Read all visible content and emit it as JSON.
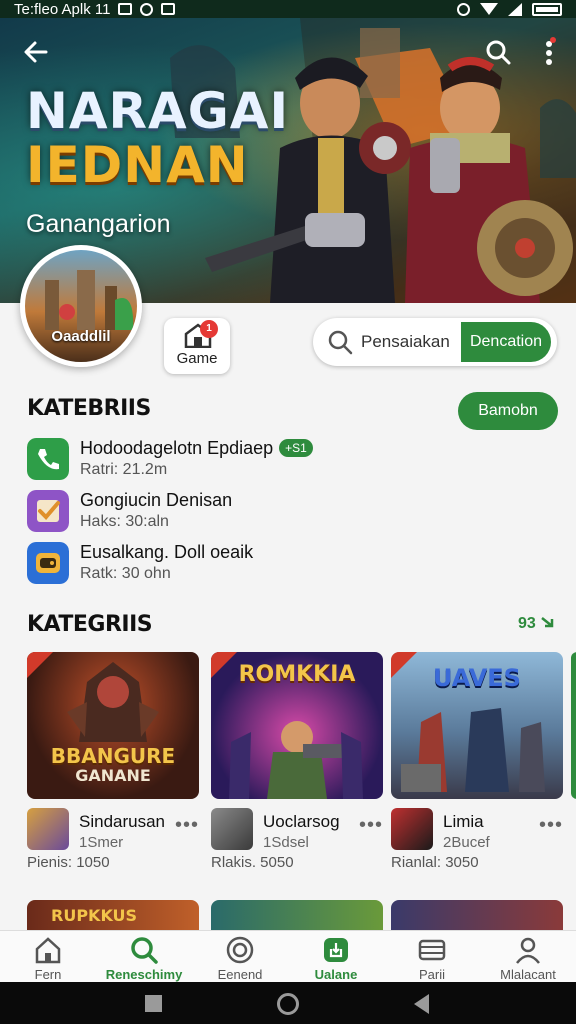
{
  "status_bar": {
    "left_text": "Te:fleo Aplk 11"
  },
  "hero": {
    "title_line1": "NARAGAI",
    "title_line2": "IEDNAN",
    "subtitle": "Ganangarion"
  },
  "avatar": {
    "label": "Oaaddlil"
  },
  "game_chip": {
    "label": "Game",
    "badge": "1"
  },
  "search": {
    "placeholder": "Pensaiakan",
    "button_label": "Dencation"
  },
  "section1": {
    "title": "KATEBRIIS",
    "button_label": "Bamobn",
    "items": [
      {
        "title": "Hodoodagelotn Epdiaep",
        "tag": "+S1",
        "meta": "Ratri: 21.2m",
        "icon": "phone-icon",
        "color": "#2e9e48"
      },
      {
        "title": "Gongiucin Denisan",
        "meta": "Haks: 30:aln",
        "icon": "check-icon",
        "color": "#8e54c6"
      },
      {
        "title": "Eusalkang. Doll oeaik",
        "meta": "Ratk: 30 ohn",
        "icon": "gamepad-icon",
        "color": "#2b6fd6"
      }
    ]
  },
  "section2": {
    "title": "KATEGRIIS",
    "see_all": "93",
    "cards": [
      {
        "thumb_title": "BBANGURE",
        "thumb_sub": "GANANE",
        "name": "Sindarusan",
        "sub": "1Smer",
        "price": "Pienis: 1050"
      },
      {
        "thumb_title": "ROMKKIA",
        "thumb_sub": "",
        "name": "Uoclarsog",
        "sub": "1Sdsel",
        "price": "Rlakis. 5050"
      },
      {
        "thumb_title": "UAVES",
        "thumb_sub": "",
        "name": "Limia",
        "sub": "2Bucef",
        "price": "Rianlal: 3050"
      }
    ],
    "row2_titles": [
      "RUPKKUS",
      "",
      ""
    ]
  },
  "bottom_nav": {
    "items": [
      {
        "label": "Fern",
        "icon": "home-icon"
      },
      {
        "label": "Reneschimy",
        "icon": "search-icon"
      },
      {
        "label": "Eenend",
        "icon": "target-icon"
      },
      {
        "label": "Ualane",
        "icon": "download-icon"
      },
      {
        "label": "Parii",
        "icon": "stack-icon"
      },
      {
        "label": "Mlalacant",
        "icon": "person-icon"
      }
    ],
    "active_index": 1
  },
  "colors": {
    "accent": "#2e8b3d",
    "gold": "#f3b42c"
  }
}
